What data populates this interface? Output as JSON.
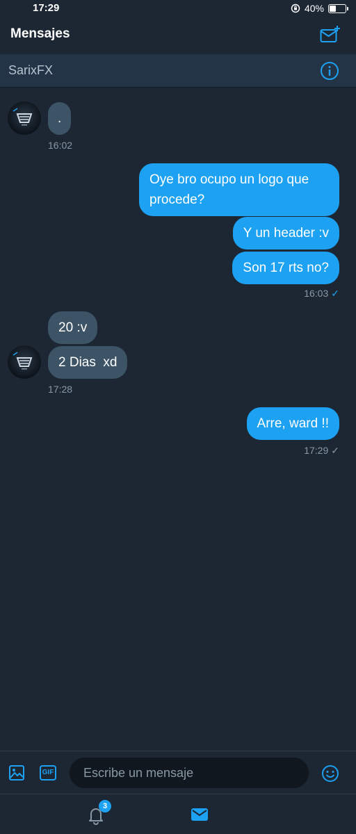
{
  "status_bar": {
    "time": "17:29",
    "battery": "40%"
  },
  "header": {
    "title": "Mensajes"
  },
  "conversation": {
    "name": "SarixFX"
  },
  "messages": [
    {
      "text": ".",
      "direction": "in"
    },
    {
      "time": "16:02"
    },
    {
      "text": "Oye bro ocupo un logo que procede?",
      "line1": "Oye bro ocupo un logo que",
      "line2": "procede?",
      "direction": "out"
    },
    {
      "text": "Y un header :v",
      "direction": "out"
    },
    {
      "text": "Son 17 rts no?",
      "direction": "out"
    },
    {
      "time": "16:03"
    },
    {
      "text": "20 :v",
      "direction": "in"
    },
    {
      "text": "2 Dias  xd",
      "direction": "in"
    },
    {
      "time": "17:28"
    },
    {
      "text": "Arre, ward !!",
      "direction": "out"
    },
    {
      "time": "17:29"
    }
  ],
  "composer": {
    "placeholder": "Escribe un mensaje",
    "gif_label": "GIF"
  },
  "tabbar": {
    "notification_count": "3"
  },
  "colors": {
    "background": "#1c2733",
    "accent": "#1da1f2",
    "incoming_bubble": "#3d5466",
    "header_bar": "#243447"
  },
  "icons": [
    "lock-rotation-icon",
    "battery-icon",
    "compose-message-icon",
    "info-icon",
    "image-icon",
    "gif-icon",
    "emoji-icon",
    "bell-icon",
    "envelope-icon",
    "checkmark-icon"
  ]
}
